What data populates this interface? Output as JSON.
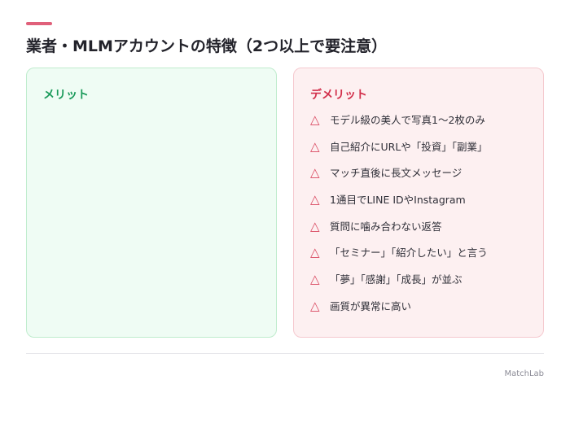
{
  "page": {
    "title": "業者・MLMアカウントの特徴（2つ以上で要注意）",
    "accent_color": "#e0607a"
  },
  "merit": {
    "heading": "メリット",
    "color": "#1a9a5a",
    "items": []
  },
  "demerit": {
    "heading": "デメリット",
    "color": "#d22f4b",
    "icon": "warning-triangle-icon",
    "icon_glyph": "△",
    "items": [
      "モデル級の美人で写真1〜2枚のみ",
      "自己紹介にURLや「投資」「副業」",
      "マッチ直後に長文メッセージ",
      "1通目でLINE IDやInstagram",
      "質問に噛み合わない返答",
      "「セミナー」「紹介したい」と言う",
      "「夢」「感謝」「成長」が並ぶ",
      "画質が異常に高い"
    ]
  },
  "footer": {
    "brand": "MatchLab"
  }
}
